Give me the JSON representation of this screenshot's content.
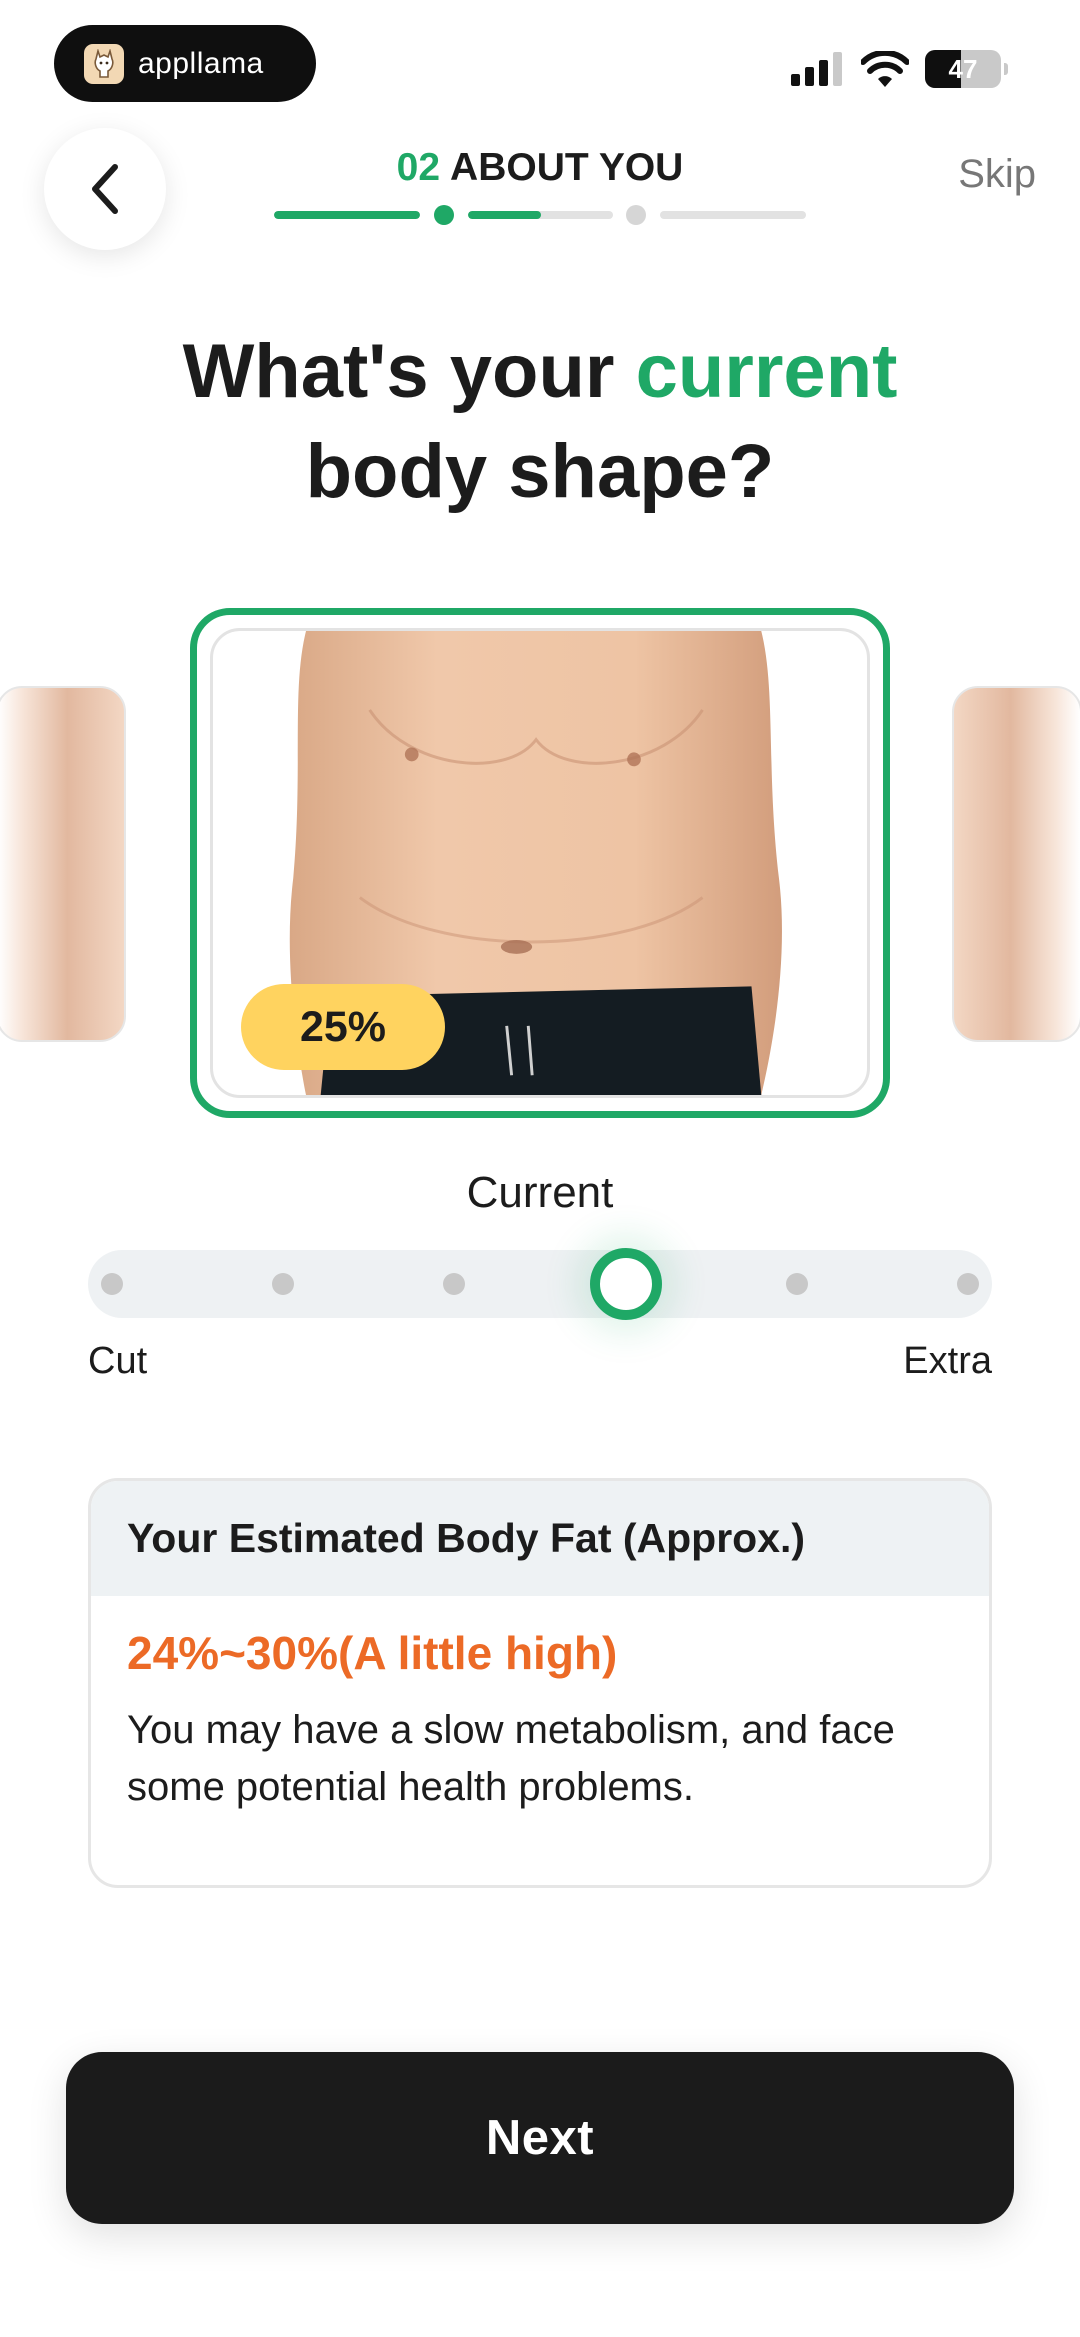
{
  "status_bar": {
    "app_name": "appllama",
    "battery_level": "47",
    "battery_fraction": 0.47
  },
  "header": {
    "step_number": "02",
    "step_label": "ABOUT YOU",
    "skip_label": "Skip",
    "progress": {
      "segments_fill": [
        1.0,
        0.5,
        0.0
      ],
      "dots_active": [
        true,
        false
      ],
      "accent_color": "#1fa866",
      "inactive_color": "#e2e2e2"
    }
  },
  "question": {
    "line1_prefix": "What's your",
    "line1_accent": "current",
    "line2": "body shape?"
  },
  "shape_card": {
    "fat_percent_label": "25%",
    "border_color": "#1fa866"
  },
  "slider": {
    "label": "Current",
    "left_label": "Cut",
    "right_label": "Extra",
    "stops": 6,
    "selected_index": 3
  },
  "estimate": {
    "title": "Your Estimated Body Fat (Approx.)",
    "range": "24%~30%(A little high)",
    "description": "You may have a slow metabolism, and face some potential health problems.",
    "range_color": "#ec6a26"
  },
  "footer": {
    "next_label": "Next"
  }
}
